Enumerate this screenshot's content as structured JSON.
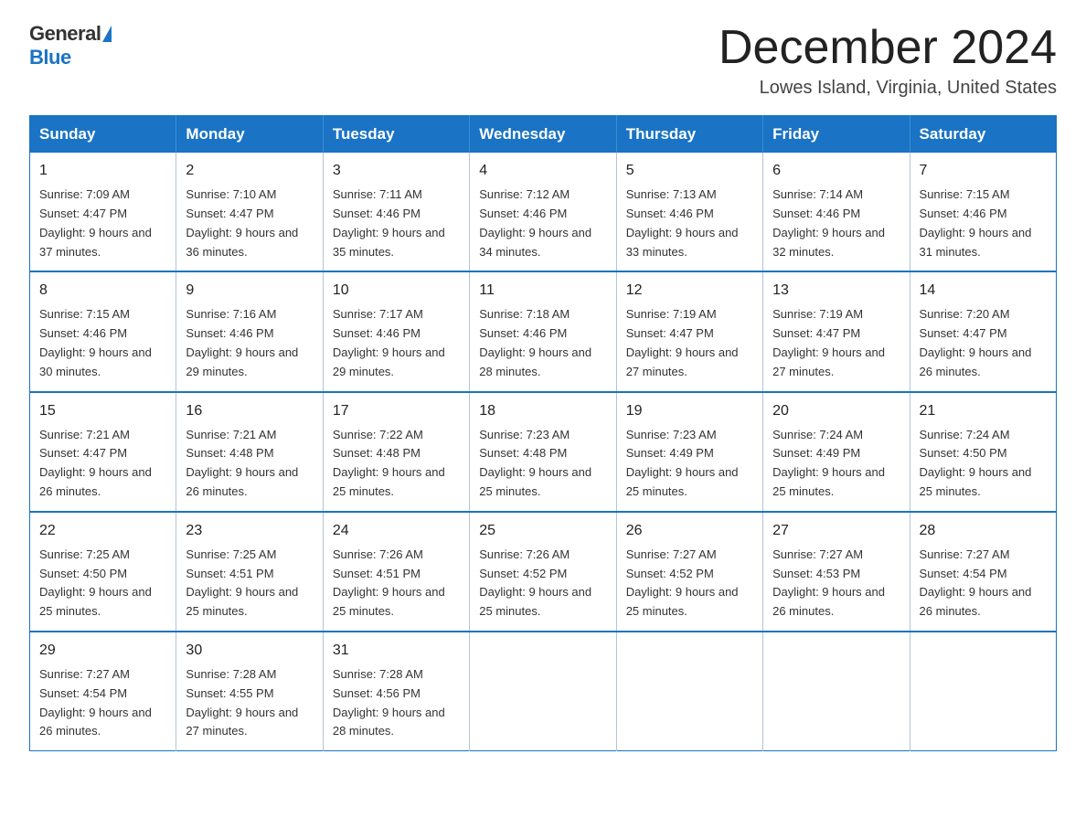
{
  "logo": {
    "general_text": "General",
    "blue_text": "Blue"
  },
  "header": {
    "title": "December 2024",
    "subtitle": "Lowes Island, Virginia, United States"
  },
  "weekdays": [
    "Sunday",
    "Monday",
    "Tuesday",
    "Wednesday",
    "Thursday",
    "Friday",
    "Saturday"
  ],
  "weeks": [
    [
      {
        "day": "1",
        "sunrise": "Sunrise: 7:09 AM",
        "sunset": "Sunset: 4:47 PM",
        "daylight": "Daylight: 9 hours and 37 minutes."
      },
      {
        "day": "2",
        "sunrise": "Sunrise: 7:10 AM",
        "sunset": "Sunset: 4:47 PM",
        "daylight": "Daylight: 9 hours and 36 minutes."
      },
      {
        "day": "3",
        "sunrise": "Sunrise: 7:11 AM",
        "sunset": "Sunset: 4:46 PM",
        "daylight": "Daylight: 9 hours and 35 minutes."
      },
      {
        "day": "4",
        "sunrise": "Sunrise: 7:12 AM",
        "sunset": "Sunset: 4:46 PM",
        "daylight": "Daylight: 9 hours and 34 minutes."
      },
      {
        "day": "5",
        "sunrise": "Sunrise: 7:13 AM",
        "sunset": "Sunset: 4:46 PM",
        "daylight": "Daylight: 9 hours and 33 minutes."
      },
      {
        "day": "6",
        "sunrise": "Sunrise: 7:14 AM",
        "sunset": "Sunset: 4:46 PM",
        "daylight": "Daylight: 9 hours and 32 minutes."
      },
      {
        "day": "7",
        "sunrise": "Sunrise: 7:15 AM",
        "sunset": "Sunset: 4:46 PM",
        "daylight": "Daylight: 9 hours and 31 minutes."
      }
    ],
    [
      {
        "day": "8",
        "sunrise": "Sunrise: 7:15 AM",
        "sunset": "Sunset: 4:46 PM",
        "daylight": "Daylight: 9 hours and 30 minutes."
      },
      {
        "day": "9",
        "sunrise": "Sunrise: 7:16 AM",
        "sunset": "Sunset: 4:46 PM",
        "daylight": "Daylight: 9 hours and 29 minutes."
      },
      {
        "day": "10",
        "sunrise": "Sunrise: 7:17 AM",
        "sunset": "Sunset: 4:46 PM",
        "daylight": "Daylight: 9 hours and 29 minutes."
      },
      {
        "day": "11",
        "sunrise": "Sunrise: 7:18 AM",
        "sunset": "Sunset: 4:46 PM",
        "daylight": "Daylight: 9 hours and 28 minutes."
      },
      {
        "day": "12",
        "sunrise": "Sunrise: 7:19 AM",
        "sunset": "Sunset: 4:47 PM",
        "daylight": "Daylight: 9 hours and 27 minutes."
      },
      {
        "day": "13",
        "sunrise": "Sunrise: 7:19 AM",
        "sunset": "Sunset: 4:47 PM",
        "daylight": "Daylight: 9 hours and 27 minutes."
      },
      {
        "day": "14",
        "sunrise": "Sunrise: 7:20 AM",
        "sunset": "Sunset: 4:47 PM",
        "daylight": "Daylight: 9 hours and 26 minutes."
      }
    ],
    [
      {
        "day": "15",
        "sunrise": "Sunrise: 7:21 AM",
        "sunset": "Sunset: 4:47 PM",
        "daylight": "Daylight: 9 hours and 26 minutes."
      },
      {
        "day": "16",
        "sunrise": "Sunrise: 7:21 AM",
        "sunset": "Sunset: 4:48 PM",
        "daylight": "Daylight: 9 hours and 26 minutes."
      },
      {
        "day": "17",
        "sunrise": "Sunrise: 7:22 AM",
        "sunset": "Sunset: 4:48 PM",
        "daylight": "Daylight: 9 hours and 25 minutes."
      },
      {
        "day": "18",
        "sunrise": "Sunrise: 7:23 AM",
        "sunset": "Sunset: 4:48 PM",
        "daylight": "Daylight: 9 hours and 25 minutes."
      },
      {
        "day": "19",
        "sunrise": "Sunrise: 7:23 AM",
        "sunset": "Sunset: 4:49 PM",
        "daylight": "Daylight: 9 hours and 25 minutes."
      },
      {
        "day": "20",
        "sunrise": "Sunrise: 7:24 AM",
        "sunset": "Sunset: 4:49 PM",
        "daylight": "Daylight: 9 hours and 25 minutes."
      },
      {
        "day": "21",
        "sunrise": "Sunrise: 7:24 AM",
        "sunset": "Sunset: 4:50 PM",
        "daylight": "Daylight: 9 hours and 25 minutes."
      }
    ],
    [
      {
        "day": "22",
        "sunrise": "Sunrise: 7:25 AM",
        "sunset": "Sunset: 4:50 PM",
        "daylight": "Daylight: 9 hours and 25 minutes."
      },
      {
        "day": "23",
        "sunrise": "Sunrise: 7:25 AM",
        "sunset": "Sunset: 4:51 PM",
        "daylight": "Daylight: 9 hours and 25 minutes."
      },
      {
        "day": "24",
        "sunrise": "Sunrise: 7:26 AM",
        "sunset": "Sunset: 4:51 PM",
        "daylight": "Daylight: 9 hours and 25 minutes."
      },
      {
        "day": "25",
        "sunrise": "Sunrise: 7:26 AM",
        "sunset": "Sunset: 4:52 PM",
        "daylight": "Daylight: 9 hours and 25 minutes."
      },
      {
        "day": "26",
        "sunrise": "Sunrise: 7:27 AM",
        "sunset": "Sunset: 4:52 PM",
        "daylight": "Daylight: 9 hours and 25 minutes."
      },
      {
        "day": "27",
        "sunrise": "Sunrise: 7:27 AM",
        "sunset": "Sunset: 4:53 PM",
        "daylight": "Daylight: 9 hours and 26 minutes."
      },
      {
        "day": "28",
        "sunrise": "Sunrise: 7:27 AM",
        "sunset": "Sunset: 4:54 PM",
        "daylight": "Daylight: 9 hours and 26 minutes."
      }
    ],
    [
      {
        "day": "29",
        "sunrise": "Sunrise: 7:27 AM",
        "sunset": "Sunset: 4:54 PM",
        "daylight": "Daylight: 9 hours and 26 minutes."
      },
      {
        "day": "30",
        "sunrise": "Sunrise: 7:28 AM",
        "sunset": "Sunset: 4:55 PM",
        "daylight": "Daylight: 9 hours and 27 minutes."
      },
      {
        "day": "31",
        "sunrise": "Sunrise: 7:28 AM",
        "sunset": "Sunset: 4:56 PM",
        "daylight": "Daylight: 9 hours and 28 minutes."
      },
      null,
      null,
      null,
      null
    ]
  ]
}
